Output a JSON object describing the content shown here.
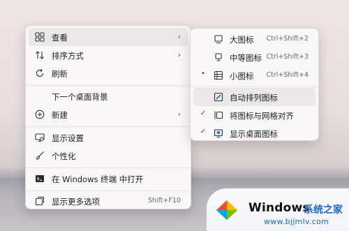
{
  "context_menu": {
    "items": [
      {
        "label": "查看",
        "icon": "view-grid-icon"
      },
      {
        "label": "排序方式",
        "icon": "sort-arrows-icon"
      },
      {
        "label": "刷新",
        "icon": "refresh-icon"
      },
      {
        "label": "下一个桌面背景",
        "icon": ""
      },
      {
        "label": "新建",
        "icon": "plus-circle-icon"
      },
      {
        "label": "显示设置",
        "icon": "display-settings-icon"
      },
      {
        "label": "个性化",
        "icon": "brush-icon"
      },
      {
        "label": "在 Windows 终端 中打开",
        "icon": "terminal-icon"
      },
      {
        "label": "显示更多选项",
        "icon": "more-options-icon",
        "shortcut": "Shift+F10"
      }
    ]
  },
  "view_submenu": {
    "items": [
      {
        "label": "大图标",
        "icon": "large-icon-monitor-icon",
        "shortcut": "Ctrl+Shift+2",
        "mark": ""
      },
      {
        "label": "中等图标",
        "icon": "medium-icon-monitor-icon",
        "shortcut": "Ctrl+Shift+3",
        "mark": ""
      },
      {
        "label": "小图标",
        "icon": "small-icon-list-icon",
        "shortcut": "Ctrl+Shift+4",
        "mark": "•"
      },
      {
        "label": "自动排列图标",
        "icon": "auto-arrange-icon",
        "mark": ""
      },
      {
        "label": "将图标与网格对齐",
        "icon": "align-grid-icon",
        "mark": "✓"
      },
      {
        "label": "显示桌面图标",
        "icon": "show-desktop-icon",
        "mark": "✓"
      }
    ]
  },
  "watermark": {
    "brand": "Windows",
    "subtitle": "系统之家",
    "url": "www.bjjmlv.com"
  }
}
